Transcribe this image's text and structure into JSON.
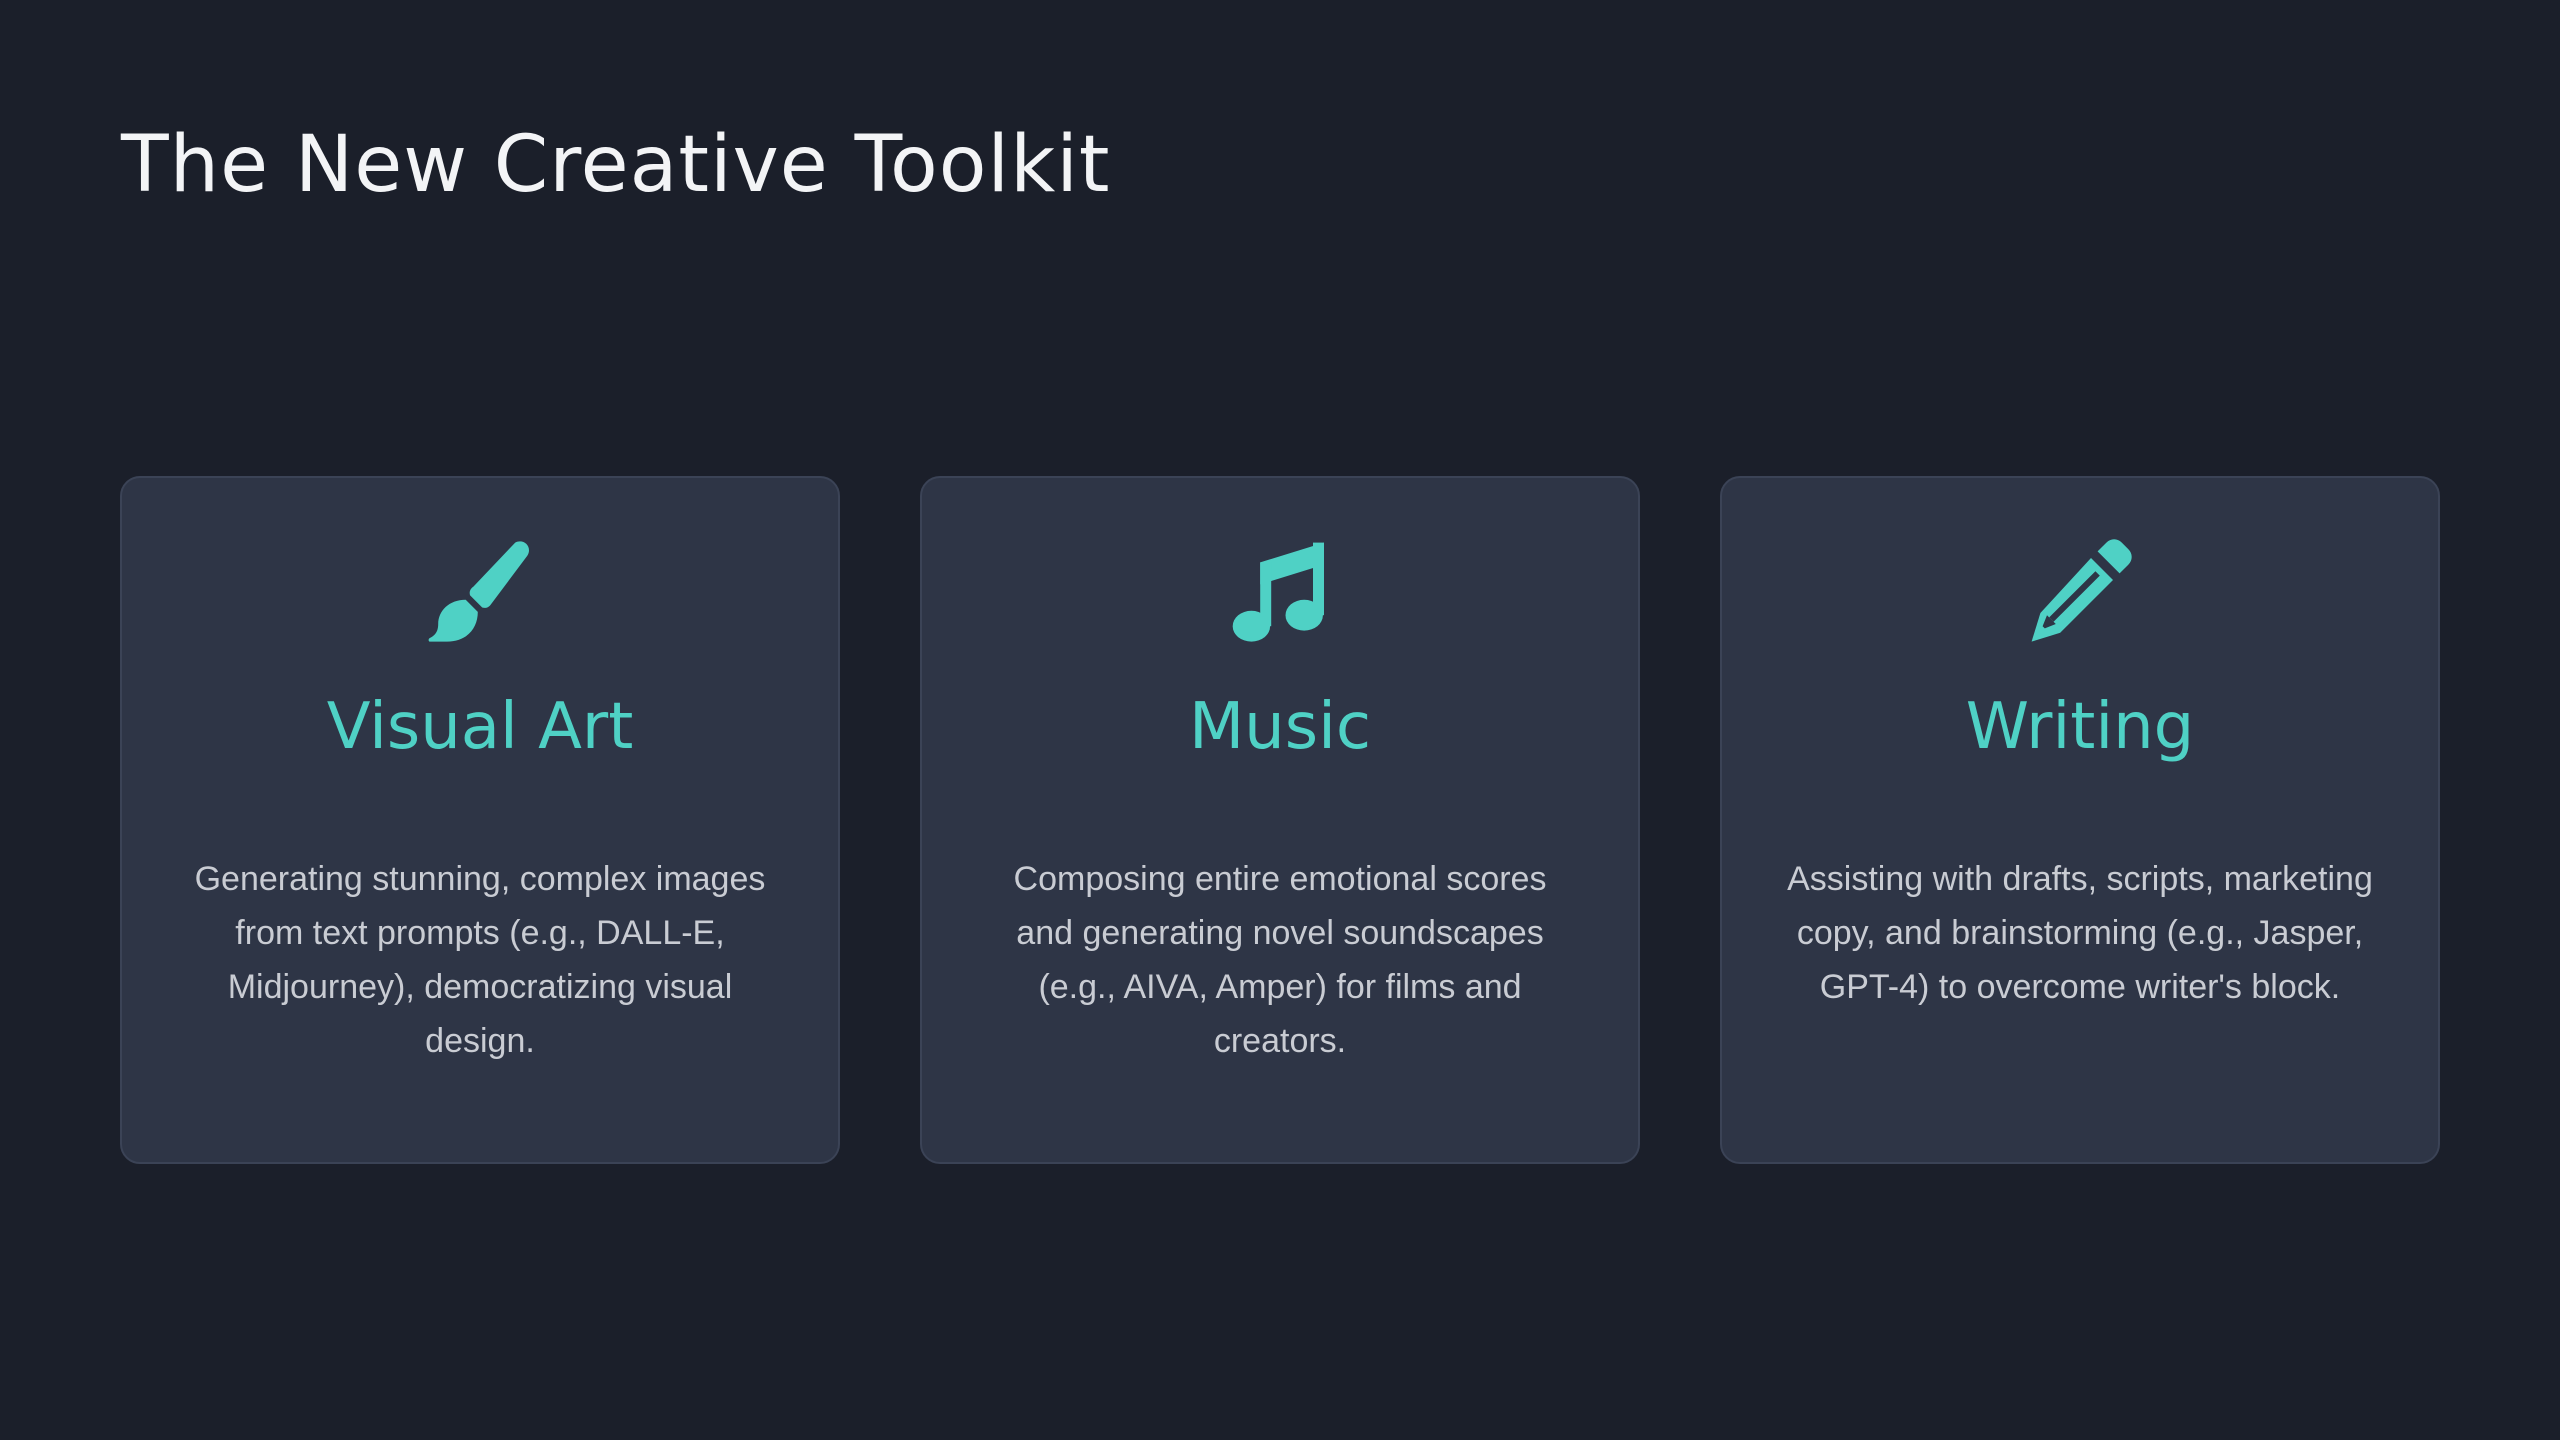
{
  "slide": {
    "title": "The New Creative Toolkit",
    "background_color": "#1b1f2a",
    "accent_color": "#4fd1c5",
    "card_color": "#2e3546"
  },
  "cards": [
    {
      "icon": "paintbrush-icon",
      "title": "Visual Art",
      "description": "Generating stunning, complex images from text prompts (e.g., DALL-E, Midjourney), democratizing visual design."
    },
    {
      "icon": "music-note-icon",
      "title": "Music",
      "description": "Composing entire emotional scores and generating novel soundscapes (e.g., AIVA, Amper) for films and creators."
    },
    {
      "icon": "pencil-icon",
      "title": "Writing",
      "description": "Assisting with drafts, scripts, marketing copy, and brainstorming (e.g., Jasper, GPT-4) to overcome writer's block."
    }
  ]
}
